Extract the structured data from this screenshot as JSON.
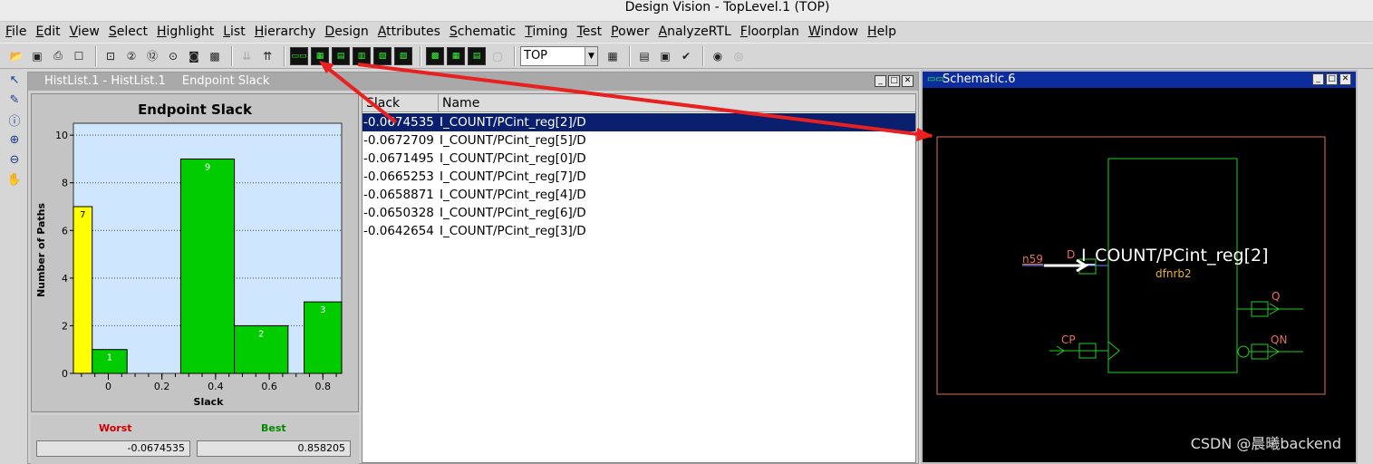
{
  "window": {
    "title": "Design Vision - TopLevel.1 (TOP)"
  },
  "menu": [
    "File",
    "Edit",
    "View",
    "Select",
    "Highlight",
    "List",
    "Hierarchy",
    "Design",
    "Attributes",
    "Schematic",
    "Timing",
    "Test",
    "Power",
    "AnalyzeRTL",
    "Floorplan",
    "Window",
    "Help"
  ],
  "toolbar": {
    "design_combo": "TOP"
  },
  "icons": {
    "open": "folder-open-icon",
    "save": "save-icon",
    "print": "print-icon",
    "select_arrow": "pointer-icon",
    "pencil": "pencil-icon",
    "info": "info-icon",
    "zoom_in": "zoom-in-icon",
    "zoom_out": "zoom-out-icon",
    "pan": "hand-icon"
  },
  "histlist": {
    "title": "HistList.1 - HistList.1",
    "subtitle": "Endpoint Slack",
    "worst_label": "Worst",
    "best_label": "Best",
    "worst_value": "-0.0674535",
    "best_value": "0.858205",
    "columns": [
      "Slack",
      "Name"
    ],
    "rows": [
      {
        "slack": "-0.0674535",
        "name": "I_COUNT/PCint_reg[2]/D",
        "selected": true
      },
      {
        "slack": "-0.0672709",
        "name": "I_COUNT/PCint_reg[5]/D",
        "selected": false
      },
      {
        "slack": "-0.0671495",
        "name": "I_COUNT/PCint_reg[0]/D",
        "selected": false
      },
      {
        "slack": "-0.0665253",
        "name": "I_COUNT/PCint_reg[7]/D",
        "selected": false
      },
      {
        "slack": "-0.0658871",
        "name": "I_COUNT/PCint_reg[4]/D",
        "selected": false
      },
      {
        "slack": "-0.0650328",
        "name": "I_COUNT/PCint_reg[6]/D",
        "selected": false
      },
      {
        "slack": "-0.0642654",
        "name": "I_COUNT/PCint_reg[3]/D",
        "selected": false
      }
    ]
  },
  "chart_data": {
    "type": "bar",
    "title": "Endpoint Slack",
    "xlabel": "Slack",
    "ylabel": "Number of Paths",
    "xlim": [
      -0.13,
      0.87
    ],
    "ylim": [
      0,
      10.5
    ],
    "xticks": [
      "0",
      "0.2",
      "0.4",
      "0.6",
      "0.8"
    ],
    "xtick_values": [
      0,
      0.2,
      0.4,
      0.6,
      0.8
    ],
    "yticks": [
      "0",
      "2",
      "4",
      "6",
      "8",
      "10"
    ],
    "ytick_values": [
      0,
      2,
      4,
      6,
      8,
      10
    ],
    "grid": true,
    "bins": [
      {
        "x0": -0.13,
        "x1": -0.06,
        "value": 7,
        "color": "#ffff00"
      },
      {
        "x0": -0.06,
        "x1": 0.07,
        "value": 1,
        "color": "#00cc00"
      },
      {
        "x0": 0.27,
        "x1": 0.47,
        "value": 9,
        "color": "#00cc00"
      },
      {
        "x0": 0.47,
        "x1": 0.67,
        "value": 2,
        "color": "#00cc00"
      },
      {
        "x0": 0.73,
        "x1": 0.87,
        "value": 3,
        "color": "#00cc00"
      }
    ]
  },
  "schematic": {
    "title": "Schematic.6",
    "cell_name": "I_COUNT/PCint_reg[2]",
    "cell_type": "dfnrb2",
    "net": "n59",
    "pins": {
      "d": "D",
      "cp": "CP",
      "q": "Q",
      "qn": "QN"
    }
  },
  "watermark": "CSDN @晨曦backend",
  "colors": {
    "selection": "#0a1f6e",
    "schematic_title": "#0d2d9e",
    "worst": "#cc0000",
    "best": "#008800",
    "arrow": "#e82020"
  }
}
